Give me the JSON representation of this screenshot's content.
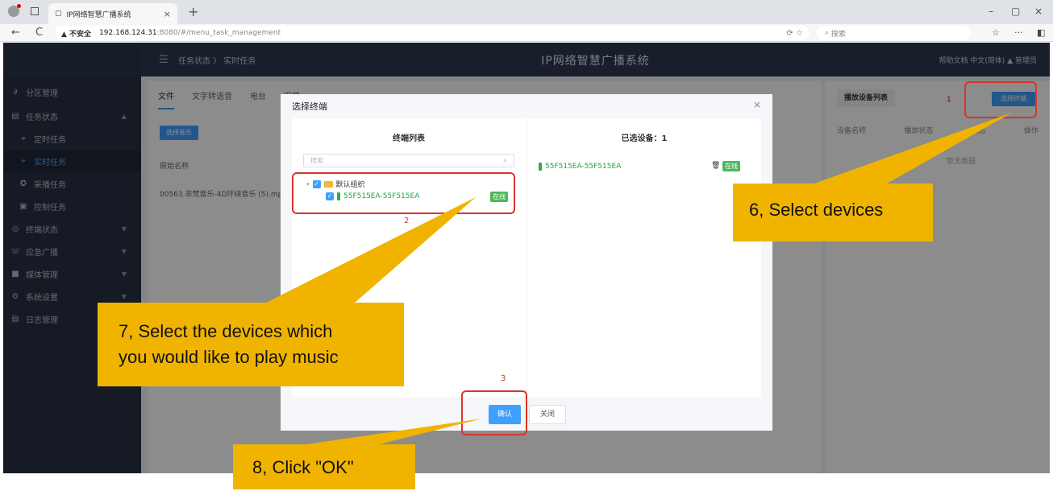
{
  "browser": {
    "tab_title": "IP网络智慧广播系统",
    "tab_close": "×",
    "new_tab": "+",
    "back": "←",
    "reload": "C",
    "security_warning": "▲ 不安全",
    "url_host": "192.168.124.31",
    "url_path": ":8080/#/menu_task_management",
    "search_placeholder": "搜索",
    "win_min": "–",
    "win_max": "▢",
    "win_close": "×"
  },
  "app": {
    "system_title": "IP网络智慧广播系统",
    "breadcrumb": "任务状态 〉 实时任务",
    "top_right": "帮助文档   中文(简体)   ▲ 管理员"
  },
  "sidebar": {
    "items": [
      {
        "label": "分区管理",
        "icon": "∂",
        "arrow": ""
      },
      {
        "label": "任务状态",
        "icon": "▤",
        "arrow": "▲"
      },
      {
        "label": "定时任务",
        "icon": "⌖",
        "arrow": ""
      },
      {
        "label": "实时任务",
        "icon": "⌖",
        "arrow": ""
      },
      {
        "label": "采播任务",
        "icon": "✪",
        "arrow": ""
      },
      {
        "label": "控制任务",
        "icon": "▣",
        "arrow": ""
      },
      {
        "label": "终端状态",
        "icon": "◎",
        "arrow": "▼"
      },
      {
        "label": "应急广播",
        "icon": "☏",
        "arrow": "▼"
      },
      {
        "label": "媒体管理",
        "icon": "■",
        "arrow": "▼"
      },
      {
        "label": "系统设置",
        "icon": "⚙",
        "arrow": "▼"
      },
      {
        "label": "日志管理",
        "icon": "▤",
        "arrow": ""
      }
    ]
  },
  "main": {
    "tabs": [
      "文件",
      "文字转语音",
      "电台",
      "采播"
    ],
    "select_music_button": "选择音乐",
    "column_original_name": "原始名称",
    "file_name": "00563.非梵音乐-4D环绕音乐 (5).mp"
  },
  "right_panel": {
    "title": "播放设备列表",
    "annotation_number": "1",
    "select_terminal_button": "选择终端",
    "columns": [
      "设备名称",
      "播放状态",
      "状态",
      "操作"
    ],
    "empty_text": "暂无数据"
  },
  "dialog": {
    "title": "选择终端",
    "close": "×",
    "left_header": "终端列表",
    "search_placeholder": "搜索",
    "group_name": "默认组织",
    "device_name": "55F515EA-55F515EA",
    "device_status": "在线",
    "right_header": "已选设备：1",
    "selected_device": "55F515EA-55F515EA",
    "selected_status": "在线",
    "confirm_button": "确认",
    "close_button": "关闭",
    "annotation_2": "2",
    "annotation_3": "3"
  },
  "callouts": {
    "step6": "6, Select devices",
    "step7_line1": "7, Select the devices which",
    "step7_line2": "you would like to play music",
    "step8": "8, Click \"OK\""
  },
  "colors": {
    "accent": "#409eff",
    "sidebar_bg": "#273143",
    "callout": "#f0b400",
    "annotation_red": "#d9352a",
    "online_green": "#4cb85a"
  }
}
